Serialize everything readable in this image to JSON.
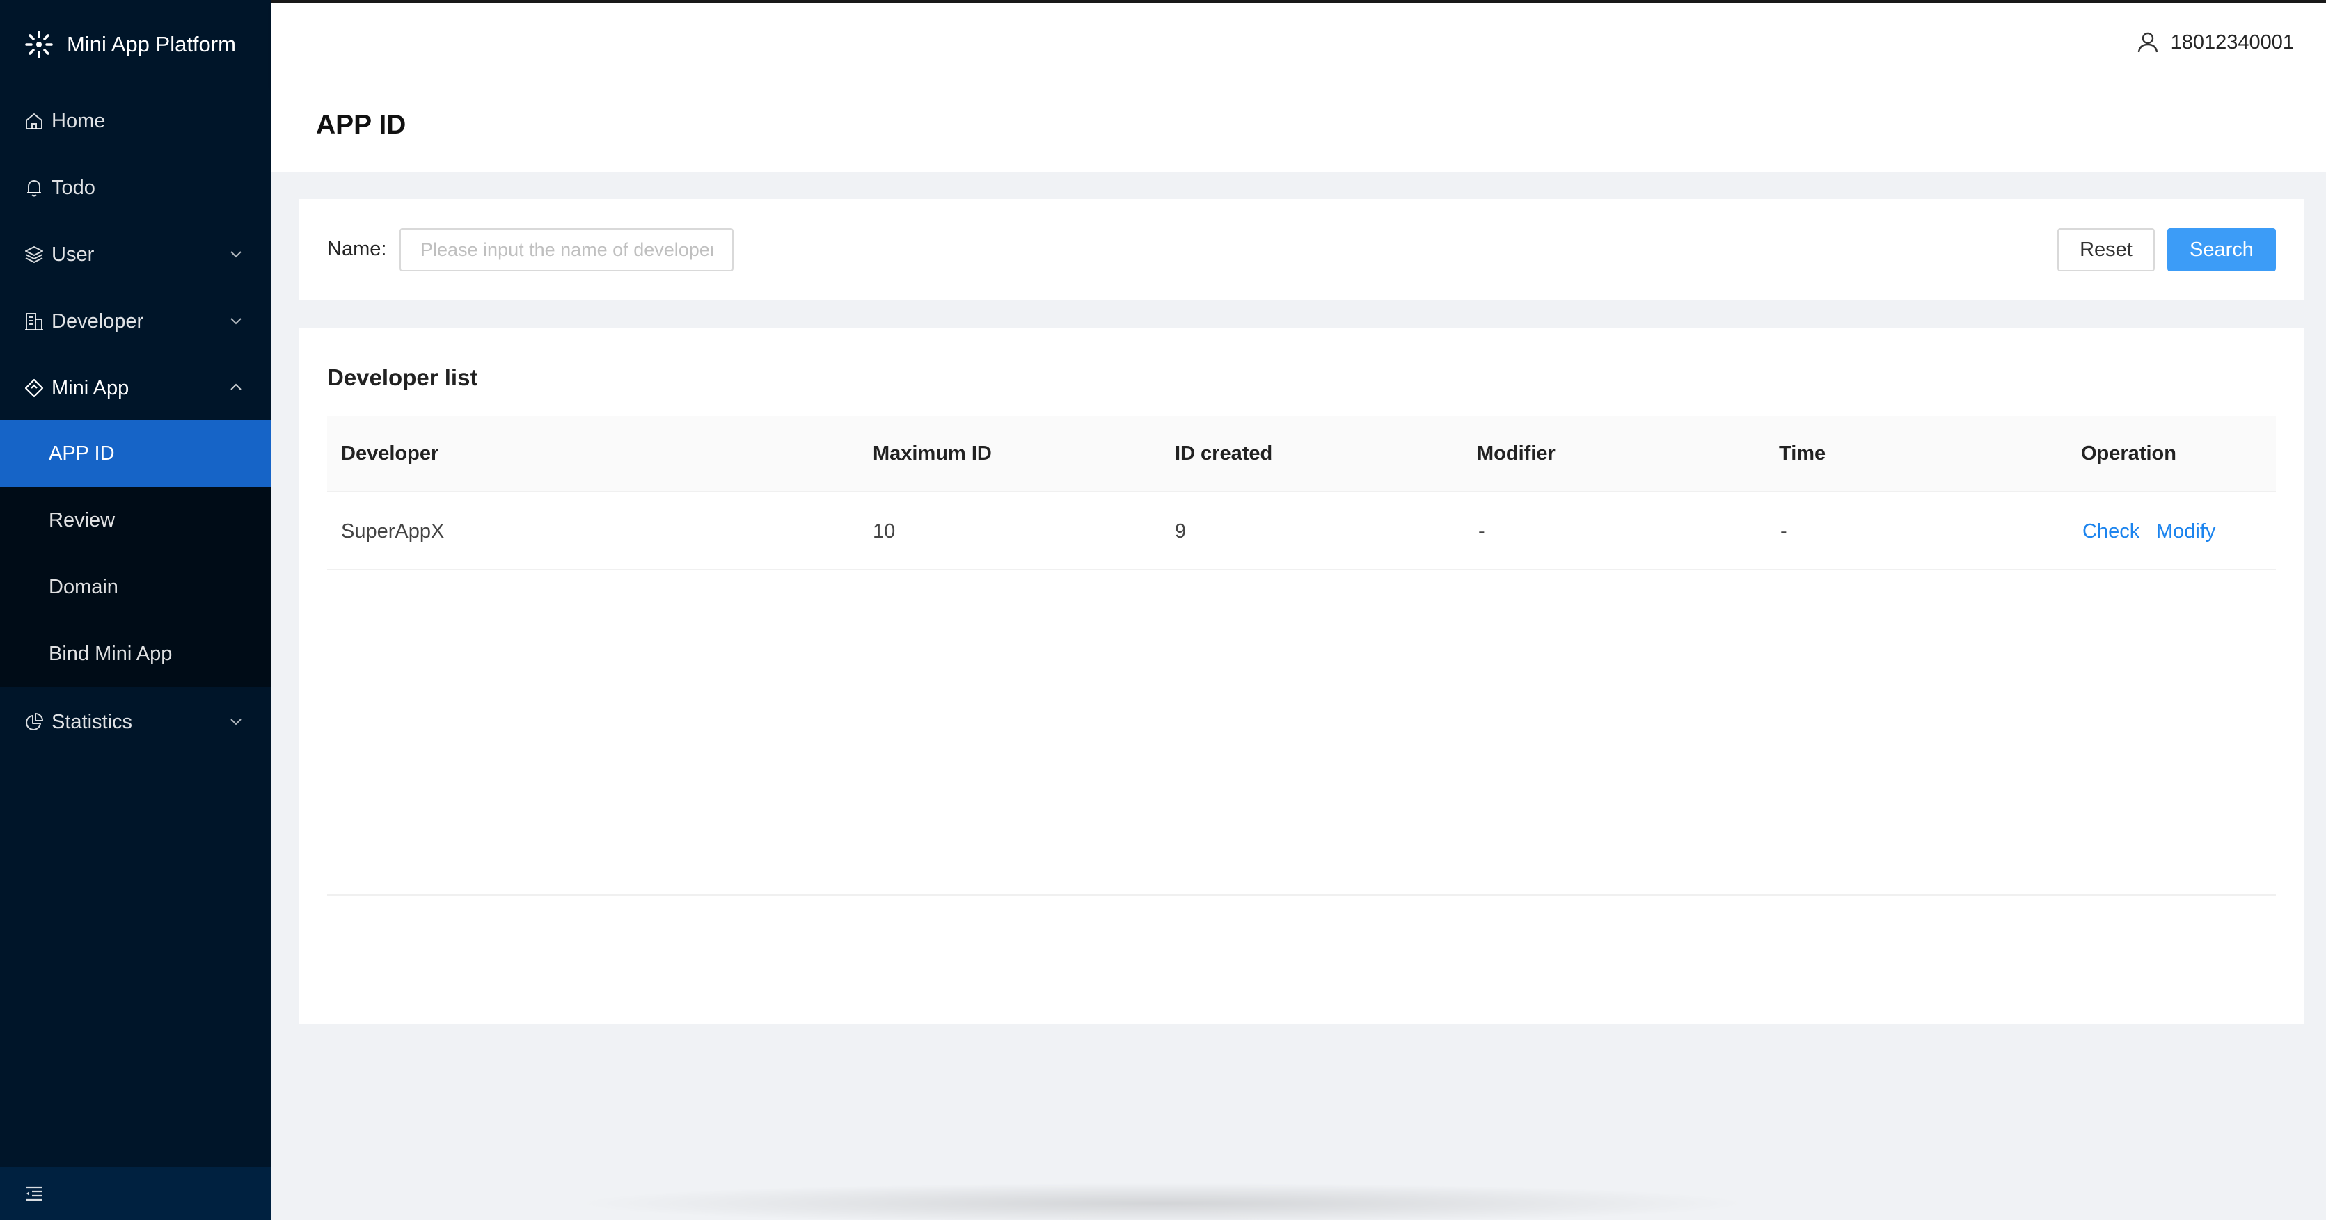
{
  "app": {
    "name": "Mini App Platform"
  },
  "sidebar": {
    "items": [
      {
        "label": "Home",
        "icon": "home-icon"
      },
      {
        "label": "Todo",
        "icon": "bell-icon"
      },
      {
        "label": "User",
        "icon": "layers-icon",
        "expandable": true
      },
      {
        "label": "Developer",
        "icon": "building-icon",
        "expandable": true
      },
      {
        "label": "Mini App",
        "icon": "diamond-icon",
        "expandable": true,
        "expanded": true
      },
      {
        "label": "Statistics",
        "icon": "pie-chart-icon",
        "expandable": true
      }
    ],
    "mini_app_children": [
      {
        "label": "APP ID",
        "active": true
      },
      {
        "label": "Review"
      },
      {
        "label": "Domain"
      },
      {
        "label": "Bind Mini App"
      }
    ]
  },
  "header": {
    "user": "18012340001"
  },
  "page": {
    "title": "APP ID"
  },
  "search": {
    "label": "Name:",
    "placeholder": "Please input the name of developer",
    "value": "",
    "reset_label": "Reset",
    "search_label": "Search"
  },
  "list": {
    "title": "Developer list",
    "columns": [
      "Developer",
      "Maximum ID",
      "ID created",
      "Modifier",
      "Time",
      "Operation"
    ],
    "rows": [
      {
        "developer": "SuperAppX",
        "maximum_id": "10",
        "id_created": "9",
        "modifier": "-",
        "time": "-",
        "actions": [
          "Check",
          "Modify"
        ]
      }
    ]
  },
  "colors": {
    "sidebar_bg": "#001529",
    "submenu_bg": "#000c17",
    "active_item": "#1664c7",
    "primary_button": "#3c9cf7",
    "link": "#1c84ee"
  }
}
